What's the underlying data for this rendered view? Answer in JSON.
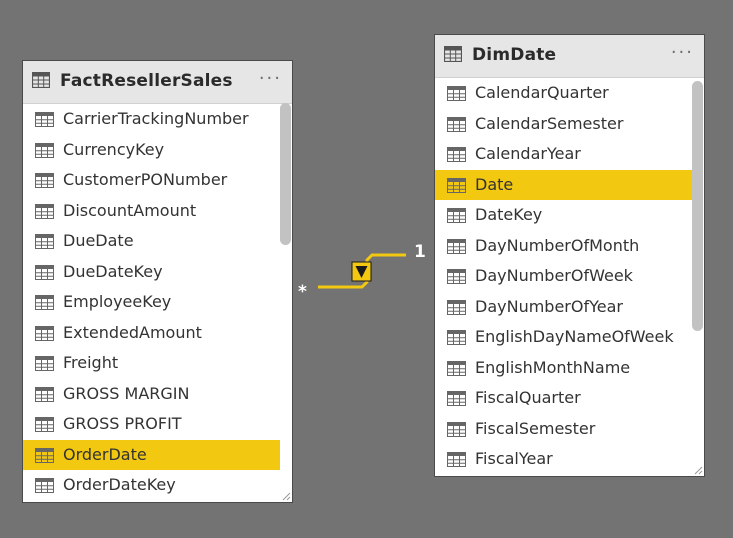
{
  "tables": {
    "fact": {
      "title": "FactResellerSales",
      "more": "···",
      "fields": [
        {
          "label": "CarrierTrackingNumber",
          "selected": false
        },
        {
          "label": "CurrencyKey",
          "selected": false
        },
        {
          "label": "CustomerPONumber",
          "selected": false
        },
        {
          "label": "DiscountAmount",
          "selected": false
        },
        {
          "label": "DueDate",
          "selected": false
        },
        {
          "label": "DueDateKey",
          "selected": false
        },
        {
          "label": "EmployeeKey",
          "selected": false
        },
        {
          "label": "ExtendedAmount",
          "selected": false
        },
        {
          "label": "Freight",
          "selected": false
        },
        {
          "label": "GROSS MARGIN",
          "selected": false
        },
        {
          "label": "GROSS PROFIT",
          "selected": false
        },
        {
          "label": "OrderDate",
          "selected": true
        },
        {
          "label": "OrderDateKey",
          "selected": false
        }
      ],
      "scroll_position": 0
    },
    "dim": {
      "title": "DimDate",
      "more": "···",
      "fields": [
        {
          "label": "CalendarQuarter",
          "selected": false
        },
        {
          "label": "CalendarSemester",
          "selected": false
        },
        {
          "label": "CalendarYear",
          "selected": false
        },
        {
          "label": "Date",
          "selected": true
        },
        {
          "label": "DateKey",
          "selected": false
        },
        {
          "label": "DayNumberOfMonth",
          "selected": false
        },
        {
          "label": "DayNumberOfWeek",
          "selected": false
        },
        {
          "label": "DayNumberOfYear",
          "selected": false
        },
        {
          "label": "EnglishDayNameOfWeek",
          "selected": false
        },
        {
          "label": "EnglishMonthName",
          "selected": false
        },
        {
          "label": "FiscalQuarter",
          "selected": false
        },
        {
          "label": "FiscalSemester",
          "selected": false
        },
        {
          "label": "FiscalYear",
          "selected": false
        }
      ],
      "scroll_position": 0
    }
  },
  "relationship": {
    "from_cardinality": "*",
    "to_cardinality": "1",
    "filter_direction": "single"
  },
  "colors": {
    "canvas": "#737373",
    "highlight": "#f2c811",
    "relationship_line": "#f2c811",
    "header": "#e6e6e6",
    "text": "#333333"
  },
  "icons": {
    "table_header": "table-icon",
    "field": "column-icon",
    "more": "more-options-icon",
    "relationship": "filter-direction-arrow-icon"
  }
}
